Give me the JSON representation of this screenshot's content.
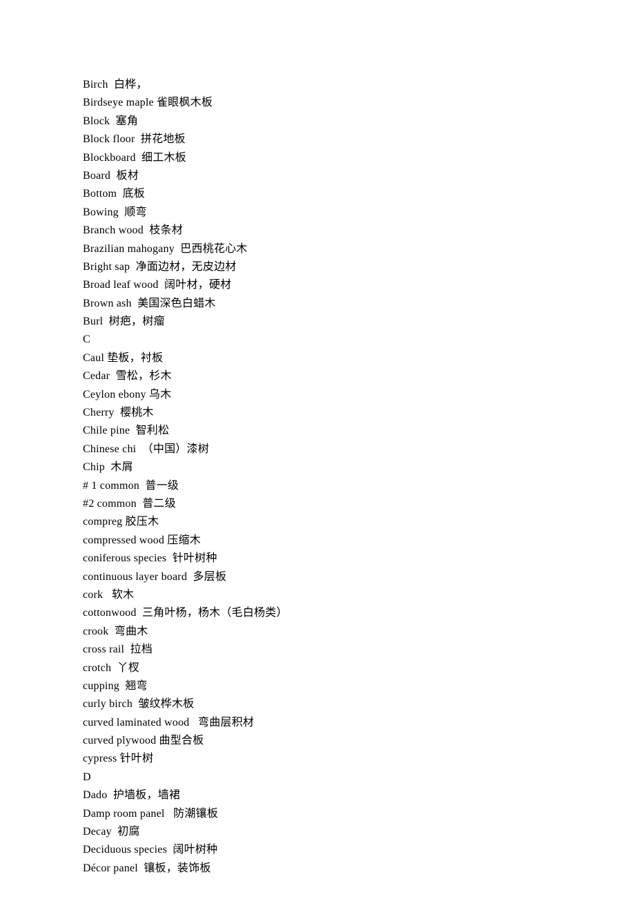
{
  "lines": [
    "Birch  白桦，",
    "Birdseye maple 雀眼枫木板",
    "Block  塞角",
    "Block floor  拼花地板",
    "Blockboard  细工木板",
    "Board  板材",
    "Bottom  底板",
    "Bowing  顺弯",
    "Branch wood  枝条材",
    "Brazilian mahogany  巴西桃花心木",
    "Bright sap  净面边材，无皮边材",
    "Broad leaf wood  阔叶材，硬材",
    "Brown ash  美国深色白蜡木",
    "Burl  树疤，树瘤",
    "C",
    "Caul 垫板，衬板",
    "Cedar  雪松，杉木",
    "Ceylon ebony 乌木",
    "Cherry  樱桃木",
    "Chile pine  智利松",
    "Chinese chi  （中国）漆树",
    "Chip  木屑",
    "# 1 common  普一级",
    "#2 common  普二级",
    "compreg 胶压木",
    "compressed wood 压缩木",
    "coniferous species  针叶树种",
    "continuous layer board  多层板",
    "cork   软木",
    "cottonwood  三角叶杨，杨木（毛白杨类）",
    "crook  弯曲木",
    "cross rail  拉档",
    "crotch  丫杈",
    "cupping  翘弯",
    "curly birch  皱纹桦木板",
    "curved laminated wood   弯曲层积材",
    "curved plywood 曲型合板",
    "cypress 针叶树",
    "D",
    "Dado  护墙板，墙裙",
    "Damp room panel   防潮镶板",
    "Decay  初腐",
    "Deciduous species  阔叶树种",
    "Décor panel  镶板，装饰板"
  ]
}
